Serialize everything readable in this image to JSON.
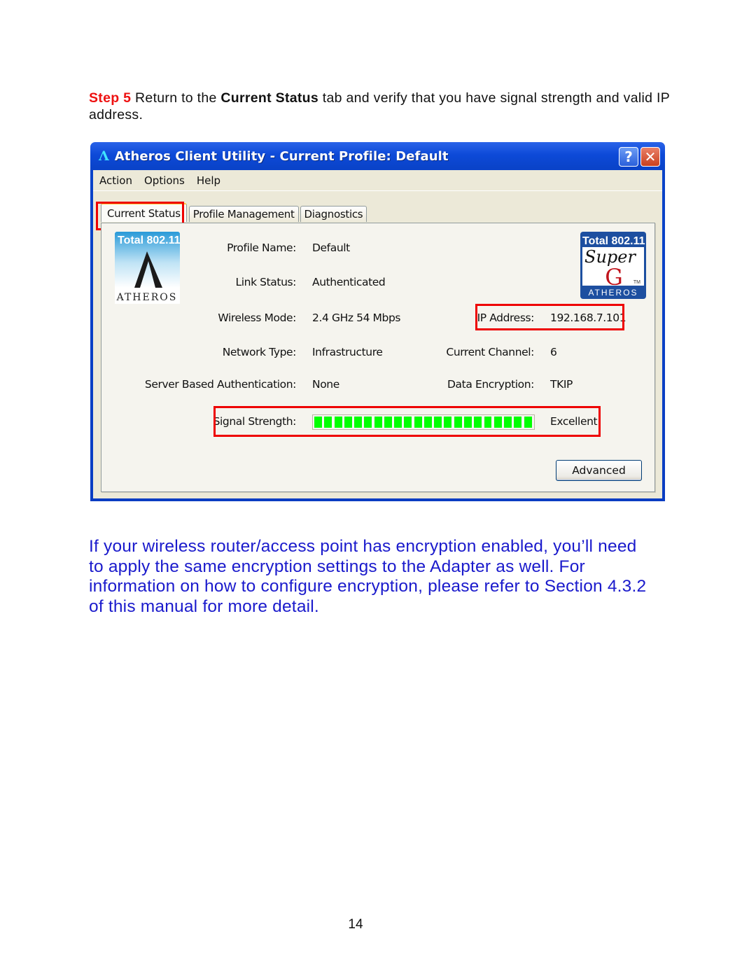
{
  "instruction": {
    "step_label": "Step 5",
    "text_before": " Return to the ",
    "bold_text": "Current Status",
    "text_after": " tab and verify that you have signal strength and valid IP address."
  },
  "window": {
    "title_icon": "atheros-logo-icon",
    "title_logo_glyph": "Λ",
    "title": "Atheros Client Utility - Current Profile: Default",
    "help_glyph": "?",
    "close_glyph": "✕",
    "menu": [
      "Action",
      "Options",
      "Help"
    ],
    "tabs": [
      {
        "label": "Current Status",
        "active": true
      },
      {
        "label": "Profile Management",
        "active": false
      },
      {
        "label": "Diagnostics",
        "active": false
      }
    ],
    "logo_left": {
      "top_text": "Total 802.11",
      "brand": "ATHEROS"
    },
    "logo_right": {
      "top_text": "Total 802.11",
      "script": "Super",
      "letter": "G",
      "tm": "TM",
      "brand": "ATHEROS"
    },
    "status": {
      "profile_name": {
        "label": "Profile Name:",
        "value": "Default"
      },
      "link_status": {
        "label": "Link Status:",
        "value": "Authenticated"
      },
      "wireless_mode": {
        "label": "Wireless Mode:",
        "value": "2.4 GHz 54 Mbps"
      },
      "ip_address": {
        "label": "IP Address:",
        "value": "192.168.7.101"
      },
      "network_type": {
        "label": "Network Type:",
        "value": "Infrastructure"
      },
      "current_channel": {
        "label": "Current Channel:",
        "value": "6"
      },
      "server_auth": {
        "label": "Server Based Authentication:",
        "value": "None"
      },
      "data_encryption": {
        "label": "Data Encryption:",
        "value": "TKIP"
      },
      "signal_strength": {
        "label": "Signal Strength:",
        "value": "Excellent",
        "segments_filled": 22,
        "segments_total": 22
      }
    },
    "advanced_button": "Advanced",
    "colors": {
      "highlight": "#ee0000",
      "signal": "#00ff00"
    }
  },
  "note": "If your wireless router/access point has encryption enabled, you’ll need to apply the same encryption settings to the Adapter as well. For information on how to configure encryption, please refer to Section 4.3.2 of this manual for more detail.",
  "page_number": "14"
}
